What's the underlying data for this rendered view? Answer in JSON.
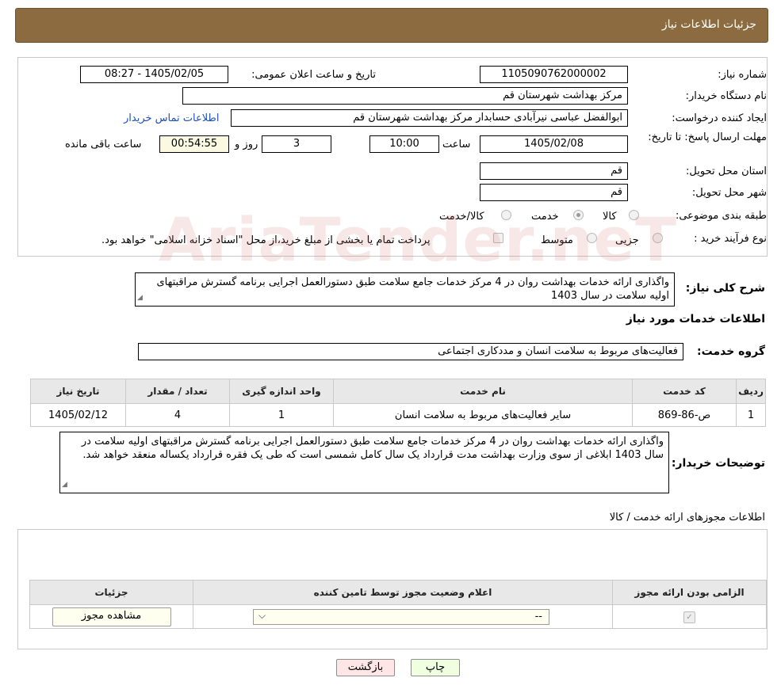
{
  "header": {
    "title": "جزئیات اطلاعات نیاز"
  },
  "form": {
    "need_number_label": "شماره نیاز:",
    "need_number": "1105090762000002",
    "announce_label": "تاریخ و ساعت اعلان عمومی:",
    "announce_value": "1405/02/05 - 08:27",
    "buyer_org_label": "نام دستگاه خریدار:",
    "buyer_org": "مرکز بهداشت شهرستان قم",
    "creator_label": "ایجاد کننده درخواست:",
    "creator": "ابوالفضل عباسی نیرآبادی حسابدار مرکز بهداشت شهرستان قم",
    "contact_link": "اطلاعات تماس خریدار",
    "deadline_label": "مهلت ارسال پاسخ: تا تاریخ:",
    "deadline_date": "1405/02/08",
    "time_label": "ساعت",
    "deadline_time": "10:00",
    "days": "3",
    "days_label": "روز و",
    "remaining": "00:54:55",
    "remaining_label": "ساعت باقی مانده",
    "province_label": "استان محل تحویل:",
    "province": "قم",
    "city_label": "شهر محل تحویل:",
    "city": "قم",
    "category_label": "طبقه بندی موضوعی:",
    "category_options": [
      "کالا",
      "خدمت",
      "کالا/خدمت"
    ],
    "category_selected": "خدمت",
    "process_label": "نوع فرآیند خرید :",
    "process_options": [
      "جزیی",
      "متوسط"
    ],
    "process_note": "پرداخت تمام یا بخشی از مبلغ خرید،از محل \"اسناد خزانه اسلامی\" خواهد بود.",
    "summary_label": "شرح کلی نیاز:",
    "summary": "واگذاری ارائه خدمات بهداشت روان در 4 مرکز خدمات جامع سلامت طبق دستورالعمل اجرایی برنامه گسترش مراقبتهای اولیه سلامت در سال 1403",
    "services_title": "اطلاعات خدمات مورد نیاز",
    "service_group_label": "گروه خدمت:",
    "service_group": "فعالیت‌های مربوط به سلامت انسان و مددکاری اجتماعی"
  },
  "services_table": {
    "headers": [
      "ردیف",
      "کد خدمت",
      "نام خدمت",
      "واحد اندازه گیری",
      "تعداد / مقدار",
      "تاریخ نیاز"
    ],
    "rows": [
      [
        "1",
        "ص-86-869",
        "سایر فعالیت‌های مربوط به سلامت انسان",
        "1",
        "4",
        "1405/02/12"
      ]
    ]
  },
  "buyer_notes": {
    "label": "توضیحات خریدار:",
    "text": "واگذاری ارائه خدمات بهداشت روان در 4 مرکز خدمات جامع سلامت طبق دستورالعمل اجرایی برنامه گسترش مراقبتهای اولیه سلامت در سال 1403  ابلاغی از سوی وزارت بهداشت مدت قرارداد یک سال کامل شمسی است که طی یک فقره قرارداد یکساله منعقد خواهد شد."
  },
  "permits": {
    "title": "اطلاعات مجوزهای ارائه خدمت / کالا",
    "headers": [
      "الزامی بودن ارائه مجوز",
      "اعلام وضعیت مجوز توسط تامین کننده",
      "جزئیات"
    ],
    "select_value": "--",
    "view_button": "مشاهده مجوز"
  },
  "footer": {
    "print": "چاپ",
    "back": "بازگشت"
  },
  "watermark": "AriaTender.neT"
}
